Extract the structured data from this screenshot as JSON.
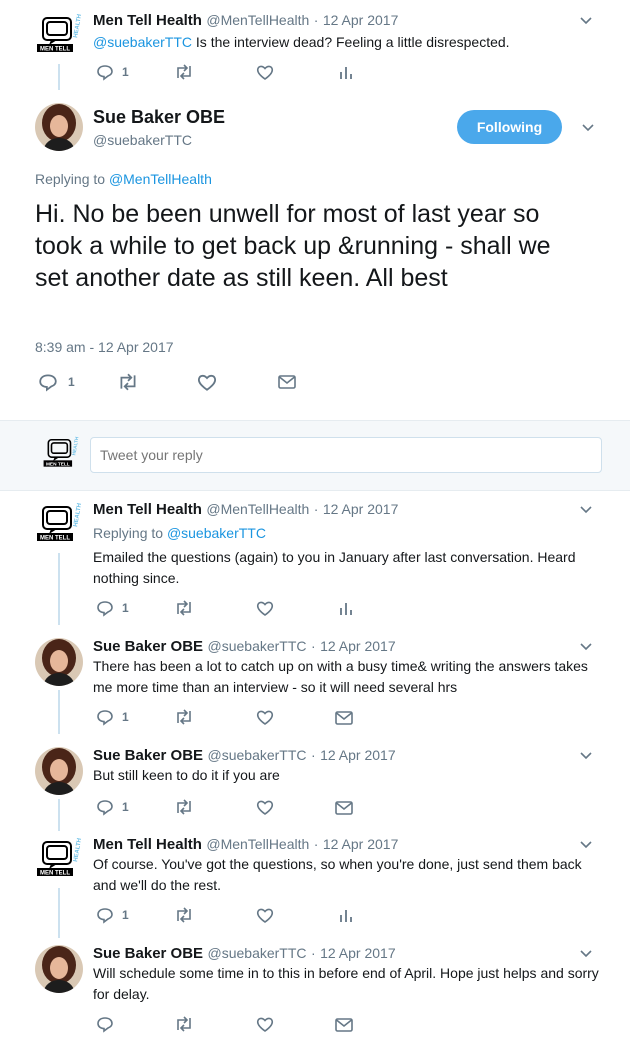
{
  "t1": {
    "name": "Men Tell Health",
    "handle": "@MenTellHealth",
    "date": "12 Apr 2017",
    "mention": "@suebakerTTC",
    "text": "Is the interview dead? Feeling a little disrespected.",
    "reply_count": "1"
  },
  "main": {
    "name": "Sue Baker OBE",
    "handle": "@suebakerTTC",
    "follow_label": "Following",
    "replying_prefix": "Replying to",
    "replying_to": "@MenTellHealth",
    "text": "Hi. No be been unwell for most of last year so took a while to get back up &running - shall we set another date as still keen. All best",
    "timestamp": "8:39 am - 12 Apr 2017",
    "reply_count": "1"
  },
  "composer": {
    "placeholder": "Tweet your reply"
  },
  "r1": {
    "name": "Men Tell Health",
    "handle": "@MenTellHealth",
    "date": "12 Apr 2017",
    "replying_prefix": "Replying to",
    "replying_to": "@suebakerTTC",
    "text": "Emailed the questions (again) to you in January after last conversation. Heard nothing since.",
    "reply_count": "1"
  },
  "r2": {
    "name": "Sue Baker OBE",
    "handle": "@suebakerTTC",
    "date": "12 Apr 2017",
    "text": "There has been a lot to catch up on with a busy time& writing the answers takes me more time than an interview - so it will need several hrs",
    "reply_count": "1"
  },
  "r3": {
    "name": "Sue Baker OBE",
    "handle": "@suebakerTTC",
    "date": "12 Apr 2017",
    "text": "But still keen to do it if you are",
    "reply_count": "1"
  },
  "r4": {
    "name": "Men Tell Health",
    "handle": "@MenTellHealth",
    "date": "12 Apr 2017",
    "text": "Of course. You've got the questions, so when you're done, just send them back and we'll do the rest.",
    "reply_count": "1"
  },
  "r5": {
    "name": "Sue Baker OBE",
    "handle": "@suebakerTTC",
    "date": "12 Apr 2017",
    "text": "Will schedule some time in to this in before end of April. Hope just helps and sorry for delay."
  },
  "dot": "·",
  "logo_text": {
    "line1": "MEN TELL",
    "line2": "HEALTH"
  },
  "colors": {
    "accent": "#1da1f2",
    "link": "#1b95e0",
    "muted": "#657786",
    "thread": "#cce1ef",
    "follow_bg": "#4aa8eb"
  }
}
